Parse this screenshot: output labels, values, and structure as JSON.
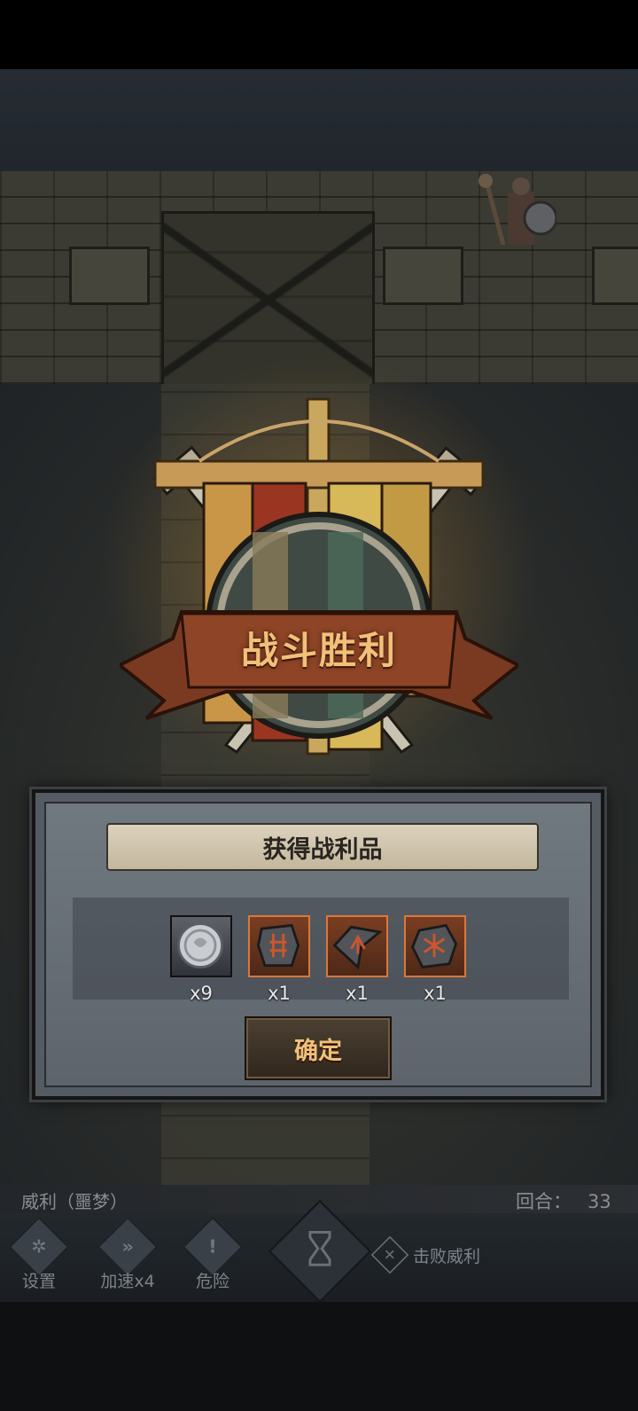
{
  "victory_title": "战斗胜利",
  "rewards_panel": {
    "title": "获得战利品",
    "items": [
      {
        "icon": "silver-coin-icon",
        "count": "x9"
      },
      {
        "icon": "rune-stone-icon",
        "count": "x1"
      },
      {
        "icon": "arrow-rune-shard-icon",
        "count": "x1"
      },
      {
        "icon": "star-rune-stone-icon",
        "count": "x1"
      }
    ],
    "confirm_label": "确定"
  },
  "status_bar": {
    "boss_name": "威利（噩梦）",
    "round_label": "回合：",
    "round_value": "33"
  },
  "hud": {
    "settings_label": "设置",
    "speed_label": "加速x4",
    "danger_label": "危险",
    "objective_label": "击败威利"
  },
  "colors": {
    "title_gold": "#f2c078",
    "rare_border": "#d9783a"
  }
}
